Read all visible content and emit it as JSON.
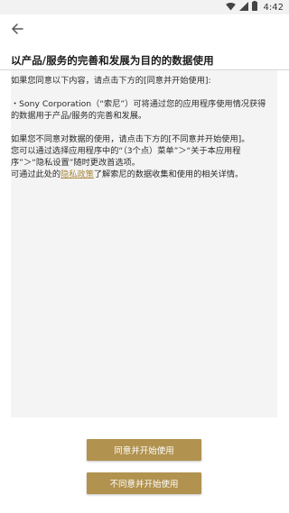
{
  "status_bar": {
    "time": "4:42",
    "icons": [
      "wifi-icon",
      "signal-icon",
      "battery-icon"
    ]
  },
  "app_bar": {
    "back_icon": "arrow-left-icon"
  },
  "page": {
    "title": "以产品/服务的完善和发展为目的的数据使用"
  },
  "content": {
    "para1": "如果您同意以下内容，请点击下方的[同意并开始使用]:",
    "para2": "・Sony Corporation（“索尼”）可将通过您的应用程序使用情况获得的数据用于产品/服务的完善和发展。",
    "para3": "如果您不同意对数据的使用，请点击下方的[不同意并开始使用]。",
    "para4": "您可以通过选择应用程序中的“（3个点）菜单”＞“关于本应用程序”＞“隐私设置”随时更改首选项。",
    "para5_prefix": "可通过此处的",
    "privacy_link": "隐私政策",
    "para5_suffix": "了解索尼的数据收集和使用的相关详情。"
  },
  "buttons": {
    "agree_label": "同意并开始使用",
    "disagree_label": "不同意并开始使用"
  },
  "colors": {
    "accent": "#b1924e",
    "link": "#a9873d",
    "panel_bg": "#f4f4f4",
    "status_bg": "#f2f2f2"
  }
}
